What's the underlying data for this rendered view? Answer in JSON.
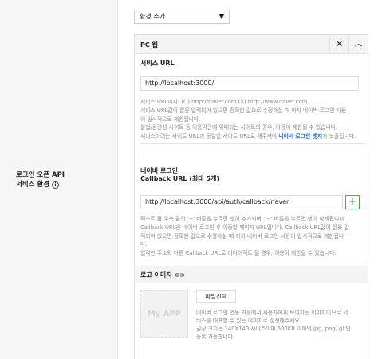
{
  "left": {
    "label_line1": "로그인 오픈 API",
    "label_line2": "서비스 환경",
    "info_icon": "ⓘ"
  },
  "env_select": {
    "value": "환경 추가",
    "caret_icon": "▼"
  },
  "panel": {
    "title": "PC 웹",
    "close_icon": "✕",
    "collapse_icon": "︿",
    "service_url": {
      "label": "서비스 URL",
      "value": "http://localhost:3000/",
      "help": [
        "서비스 URL예시: (O) http://naver.com (X) http://www.naver.com",
        "서비스 URL값이 잘못 입력되어 있으면 정확한 값으로 수정하실 때 까지 네이버 로그인 사용",
        "이 일시적으로 제한됩니다.",
        "불법/음란성 사이트 등 이용약관에 위배되는 사이트의 경우, 이용이 제한될 수 있습니다."
      ],
      "help_last_pre": "서비스하려는 사이트 URL과 동일한 사이트 URL로 해주셔야 ",
      "help_last_link": "네이버 로그인 뱃지",
      "help_last_post": "가 노출됩니다."
    },
    "callback": {
      "label_line1": "네이버 로그인",
      "label_line2": "Callback URL (최대 5개)",
      "value": "http://localhost:3000/api/auth/callback/naver",
      "add_icon": "+",
      "help": [
        "텍스트 폼 우측 끝의 '+' 버튼을 누르면 행이 추가되며, '−' 버튼을 누르면 행이 삭제됩니다.",
        "Callback URL은 네이버 로그인 후 이동할 페이지 URL입니다. Callback URL값이 잘못 입",
        "력되어 있으면 정확한 값으로 수정하실 때 까지 네이버 로그인 사용이 일시적으로 제한됩니",
        "다.",
        "입력한 주소와 다른 Callback URL로 리다이렉트 될 경우, 이용이 제한될 수 있습니다."
      ]
    },
    "logo": {
      "title": "로고 이미지",
      "link_icon": "⊂⊃",
      "placeholder": "My APP",
      "file_button": "파일선택",
      "help": [
        "네이버 로그인 연동 과정에서 사용자에게 보여지는 이미지이므로 서",
        "비스를 대표할 수 있는 이미지로 설정해주세요.",
        "권장 크기는 140X140 사이즈이며 500KB 이하의 jpg, png, gif만",
        "등록 가능합니다."
      ]
    }
  }
}
